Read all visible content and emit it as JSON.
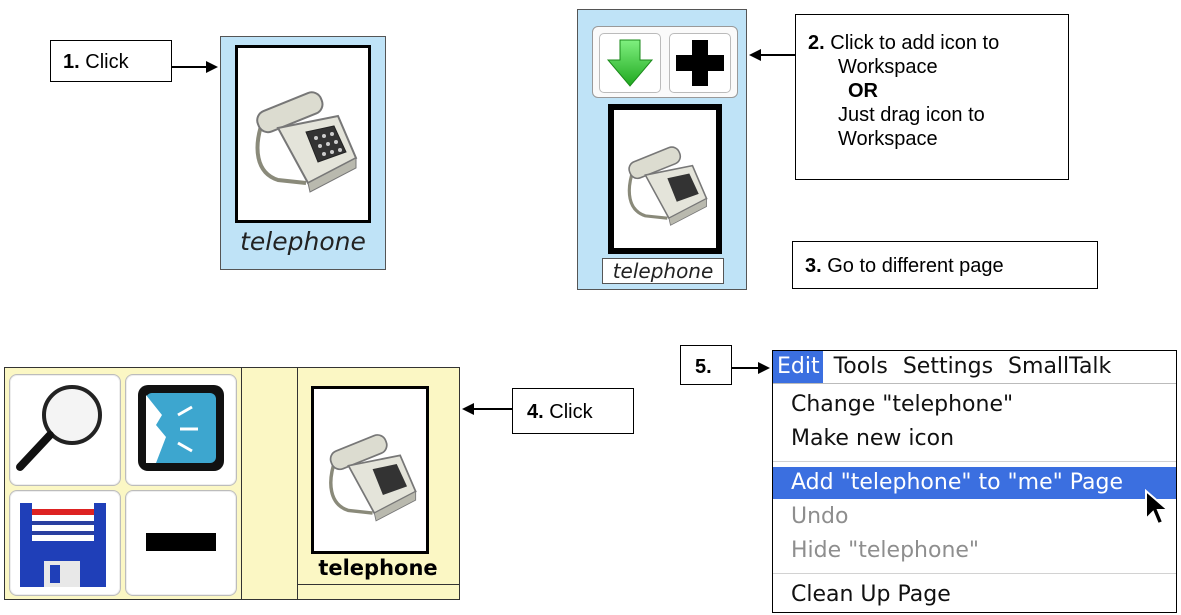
{
  "step1": {
    "num": "1.",
    "text": "Click"
  },
  "step2": {
    "num": "2.",
    "line1": "Click to add icon to",
    "line2": "Workspace",
    "or": "OR",
    "line3": "Just drag icon to",
    "line4": "Workspace"
  },
  "step3": {
    "num": "3.",
    "text": "Go to different page"
  },
  "step4": {
    "num": "4.",
    "text": "Click"
  },
  "step5": {
    "num": "5."
  },
  "icon_card_1": {
    "label": "telephone",
    "icon": "telephone-icon"
  },
  "icon_card_2": {
    "label": "telephone",
    "icon": "telephone-icon",
    "toolbar": [
      "down-arrow-icon",
      "plus-icon"
    ]
  },
  "workspace": {
    "tiles": [
      "magnifier-icon",
      "speaker-icon",
      "floppy-save-icon",
      "minus-bar-icon"
    ],
    "card_label": "telephone"
  },
  "menu": {
    "bar": [
      "Edit",
      "Tools",
      "Settings",
      "SmallTalk"
    ],
    "items": [
      {
        "label": "Change \"telephone\"",
        "state": "normal"
      },
      {
        "label": "Make new icon",
        "state": "normal"
      },
      {
        "label": "Add \"telephone\" to \"me\" Page",
        "state": "highlighted"
      },
      {
        "label": "Undo",
        "state": "disabled"
      },
      {
        "label": "Hide \"telephone\"",
        "state": "disabled"
      },
      {
        "label": "Clean Up Page",
        "state": "normal"
      }
    ]
  },
  "colors": {
    "panel_blue": "#bfe3f7",
    "panel_yellow": "#fbf7c4",
    "highlight": "#3b6fe0",
    "green_arrow": "#3fcf3f"
  }
}
